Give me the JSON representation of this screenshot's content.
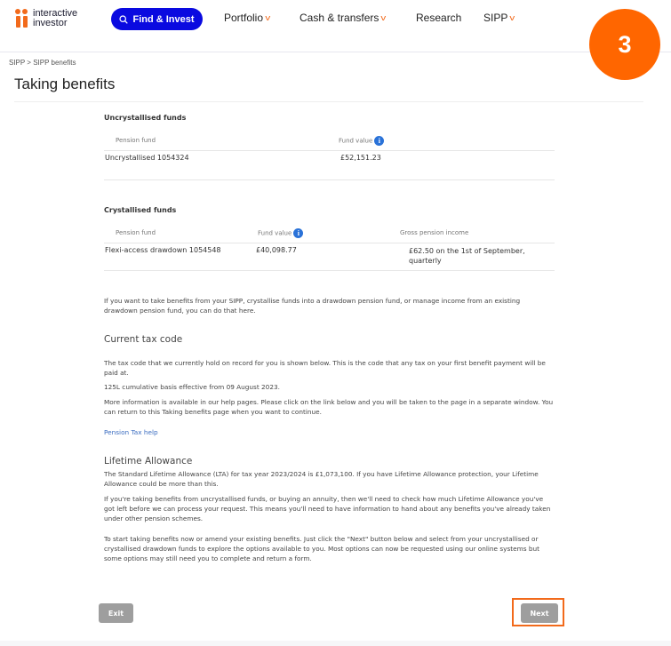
{
  "header": {
    "logo_line1": "interactive",
    "logo_line2": "investor",
    "find_invest_label": "Find & Invest",
    "nav": [
      {
        "label": "Portfolio",
        "has_dropdown": true
      },
      {
        "label": "Cash & transfers",
        "has_dropdown": true
      },
      {
        "label": "Research",
        "has_dropdown": false
      },
      {
        "label": "SIPP",
        "has_dropdown": true
      }
    ],
    "chevron_glyph": "v",
    "search_icon": "search-icon",
    "step_badge": "3",
    "accent_color": "#f26a1b",
    "brand_blue": "#0a0ae0"
  },
  "breadcrumb": "SIPP > SIPP benefits",
  "page_title": "Taking benefits",
  "uncrystallised": {
    "section_label": "Uncrystallised funds",
    "columns": [
      "Pension fund",
      "Fund value"
    ],
    "rows": [
      {
        "fund": "Uncrystallised 1054324",
        "value": "£52,151.23"
      }
    ]
  },
  "crystallised": {
    "section_label": "Crystallised funds",
    "columns": [
      "Pension fund",
      "Fund value",
      "Gross pension income"
    ],
    "rows": [
      {
        "fund": "Flexi-access drawdown 1054548",
        "value": "£40,098.77",
        "income": "£62.50 on the 1st of September, quarterly"
      }
    ]
  },
  "info_glyph": "i",
  "intro_text": "If you want to take benefits from your SIPP, crystallise funds into a drawdown pension fund, or manage income from an existing drawdown pension fund, you can do that here.",
  "tax_code": {
    "heading": "Current tax code",
    "p1": "The tax code that we currently hold on record for you is shown below. This is the code that any tax on your first benefit payment will be paid at.",
    "p2": "125L cumulative basis effective from 09 August 2023.",
    "p3": "More information is available in our help pages. Please click on the link below and you will be taken to the page in a separate window. You can return to this Taking benefits page when you want to continue.",
    "link": "Pension Tax help"
  },
  "lifetime_allowance": {
    "heading": "Lifetime Allowance",
    "p1": "The Standard Lifetime Allowance (LTA) for tax year 2023/2024 is £1,073,100. If you have Lifetime Allowance protection, your Lifetime Allowance could be more than this.",
    "p2": "If you're taking benefits from uncrystallised funds, or buying an annuity, then we'll need to check how much Lifetime Allowance you've got left before we can process your request. This means you'll need to have information to hand about any benefits you've already taken under other pension schemes."
  },
  "closing_text": "To start taking benefits now or amend your existing benefits. Just click the \"Next\" button below and select from your uncrystallised or crystallised drawdown funds to explore the options available to you. Most options can now be requested using our online systems but some options may still need you to complete and return a form.",
  "buttons": {
    "exit": "Exit",
    "next": "Next"
  }
}
